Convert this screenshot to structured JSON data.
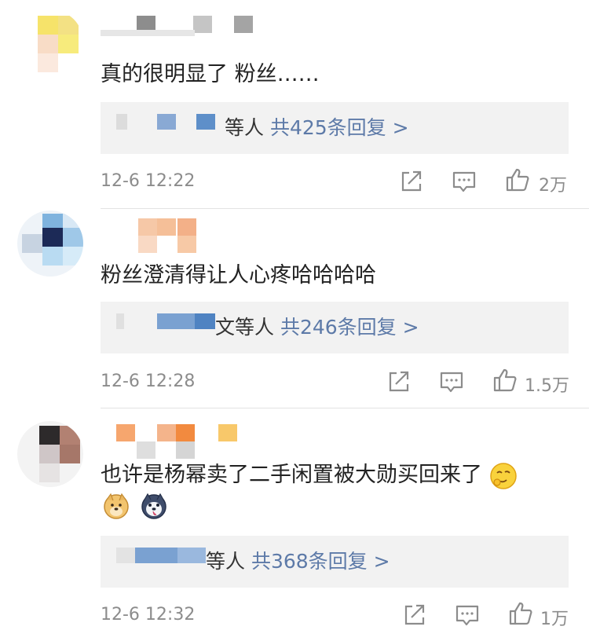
{
  "comments": [
    {
      "text": "真的很明显了 粉丝……",
      "reply_who": "等人",
      "reply_count": "共425条回复 >",
      "time": "12-6 12:22",
      "likes": "2万"
    },
    {
      "text": "粉丝澄清得让人心疼哈哈哈哈",
      "reply_who": "文等人",
      "reply_count": "共246条回复 >",
      "time": "12-6 12:28",
      "likes": "1.5万"
    },
    {
      "text": "也许是杨幂卖了二手闲置被大勋买回来了",
      "reply_who": "等人",
      "reply_count": "共368条回复 >",
      "time": "12-6 12:32",
      "likes": "1万"
    }
  ],
  "icons": {
    "share": "share-icon",
    "comment": "comment-icon",
    "like": "like-icon",
    "emoji_think": "thinking-emoji-icon",
    "emoji_doge": "doge-emoji-icon",
    "emoji_husky": "husky-emoji-icon"
  },
  "colors": {
    "reply_link": "#5d7aa8",
    "meta": "#8c8c8c",
    "reply_bg": "#f2f2f2"
  }
}
